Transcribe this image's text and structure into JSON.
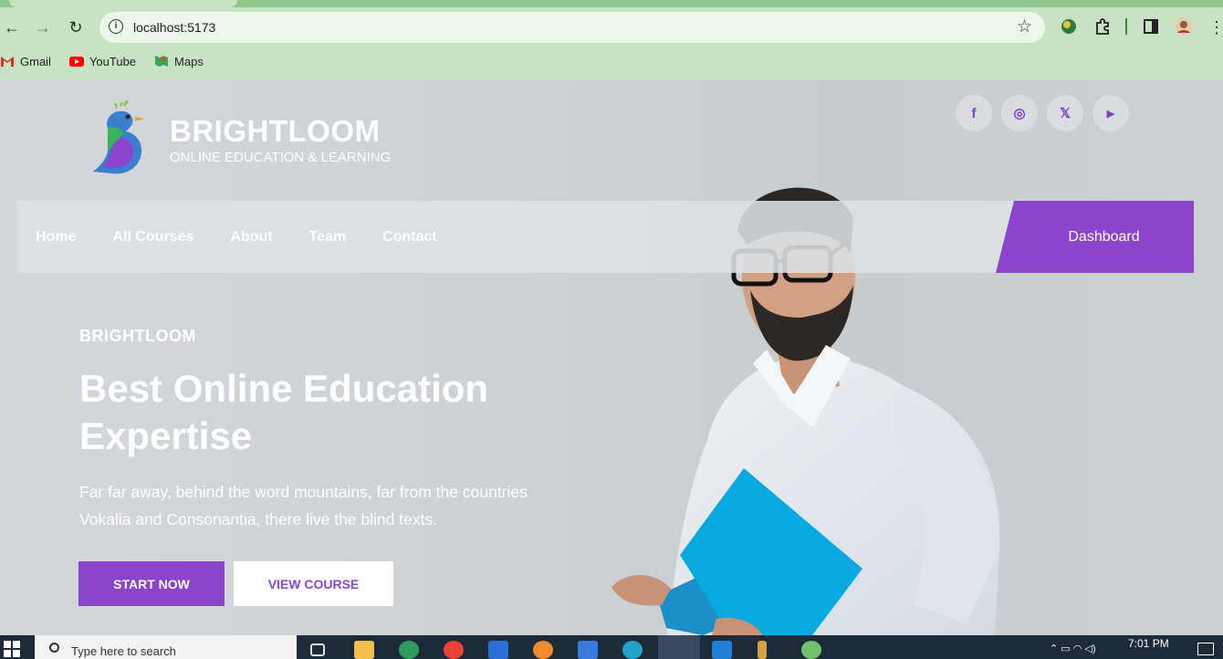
{
  "browser": {
    "url": "localhost:5173",
    "bookmarks": [
      {
        "label": "Gmail",
        "icon": "gmail-icon"
      },
      {
        "label": "YouTube",
        "icon": "youtube-icon"
      },
      {
        "label": "Maps",
        "icon": "maps-icon"
      }
    ]
  },
  "brand": {
    "name": "BRIGHTLOOM",
    "tagline": "ONLINE EDUCATION & LEARNING"
  },
  "socials": [
    {
      "glyph": "f",
      "icon": "facebook-icon"
    },
    {
      "glyph": "◎",
      "icon": "instagram-icon"
    },
    {
      "glyph": "𝕏",
      "icon": "x-icon"
    },
    {
      "glyph": "▶",
      "icon": "youtube-icon"
    }
  ],
  "nav": {
    "links": [
      "Home",
      "All Courses",
      "About",
      "Team",
      "Contact"
    ],
    "dashboard": "Dashboard"
  },
  "hero": {
    "eyebrow": "BRIGHTLOOM",
    "title": "Best Online Education Expertise",
    "description": "Far far away, behind the word mountains, far from the countries Vokalia and Consonantia, there live the blind texts.",
    "primary_button": "START NOW",
    "secondary_button": "VIEW COURSE"
  },
  "taskbar": {
    "search_placeholder": "Type here to search",
    "time": "7:01 PM"
  },
  "colors": {
    "accent": "#8a45cc",
    "chrome_bg": "#c7e3c3",
    "taskbar_bg": "#1d2a3a"
  }
}
